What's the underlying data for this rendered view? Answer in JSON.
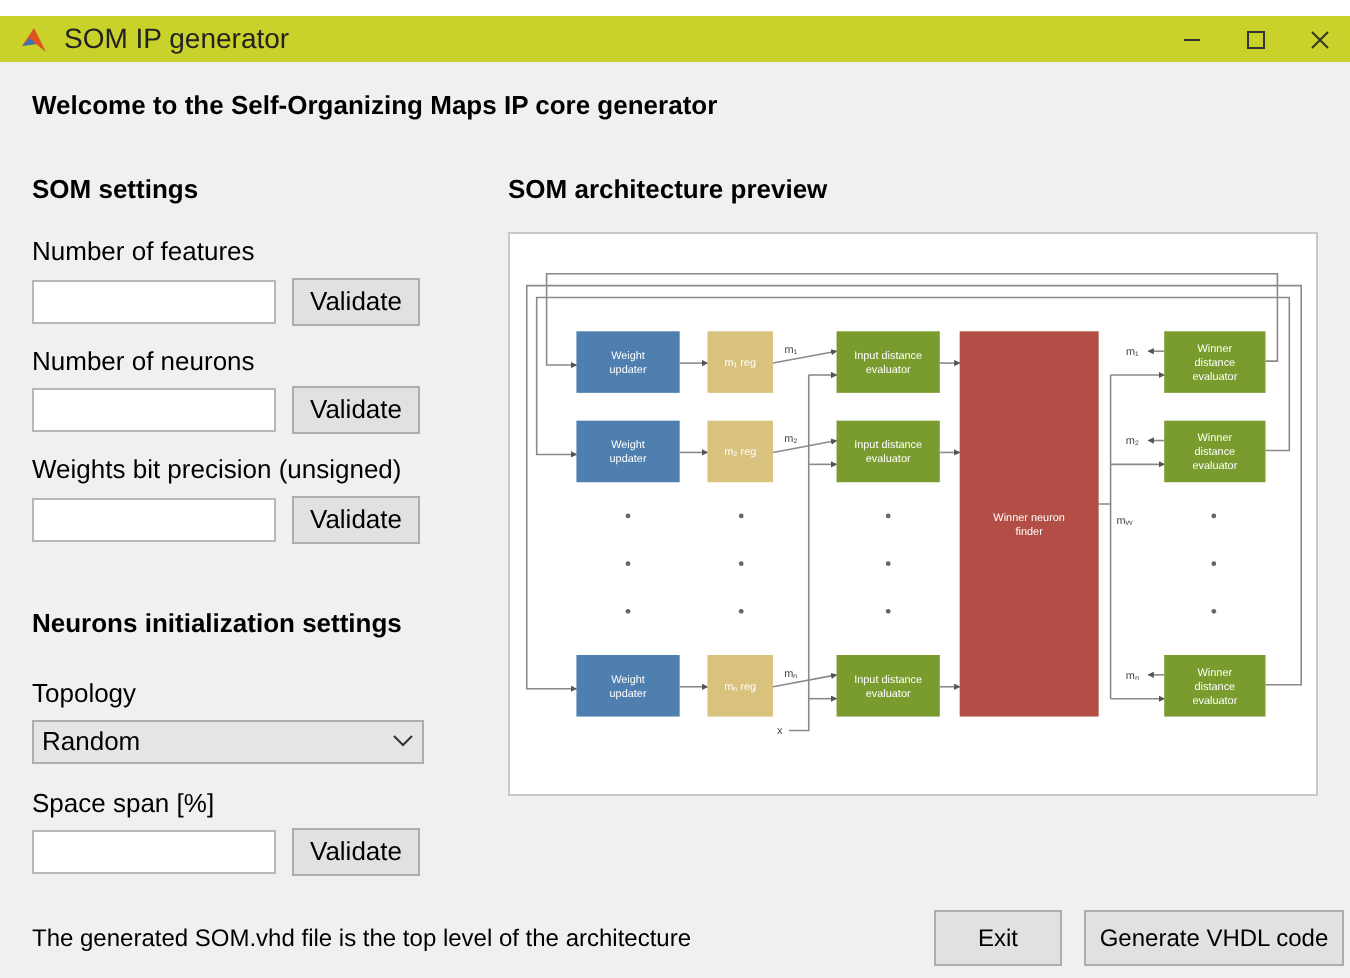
{
  "window": {
    "title": "SOM IP generator"
  },
  "welcome": "Welcome to the Self-Organizing Maps IP core generator",
  "settings": {
    "title": "SOM settings",
    "fields": [
      {
        "label": "Number of features",
        "button": "Validate"
      },
      {
        "label": "Number of neurons",
        "button": "Validate"
      },
      {
        "label": "Weights bit precision (unsigned)",
        "button": "Validate"
      }
    ]
  },
  "init": {
    "title": "Neurons initialization settings",
    "topology": {
      "label": "Topology",
      "value": "Random"
    },
    "span": {
      "label": "Space span [%]",
      "button": "Validate"
    }
  },
  "preview": {
    "title": "SOM architecture preview",
    "diagram": {
      "rows": [
        {
          "updater": "Weight updater",
          "register": "m₁ reg",
          "evaluator": "Input distance evaluator",
          "out_label": "m₁",
          "winner_label": "m₁",
          "winner_evaluator": "Winner distance evaluator"
        },
        {
          "updater": "Weight updater",
          "register": "m₂ reg",
          "evaluator": "Input distance evaluator",
          "out_label": "m₂",
          "winner_label": "m₂",
          "winner_evaluator": "Winner distance evaluator"
        },
        {
          "updater": "Weight updater",
          "register": "mₙ reg",
          "evaluator": "Input distance evaluator",
          "out_label": "mₙ",
          "winner_label": "mₙ",
          "winner_evaluator": "Winner distance evaluator"
        }
      ],
      "finder": "Winner neuron finder",
      "winner_out": "mᵥᵥ",
      "input_label": "x"
    }
  },
  "footer": {
    "note": "The generated SOM.vhd file is the top level of the architecture",
    "buttons": [
      "Exit",
      "Generate VHDL code"
    ]
  }
}
